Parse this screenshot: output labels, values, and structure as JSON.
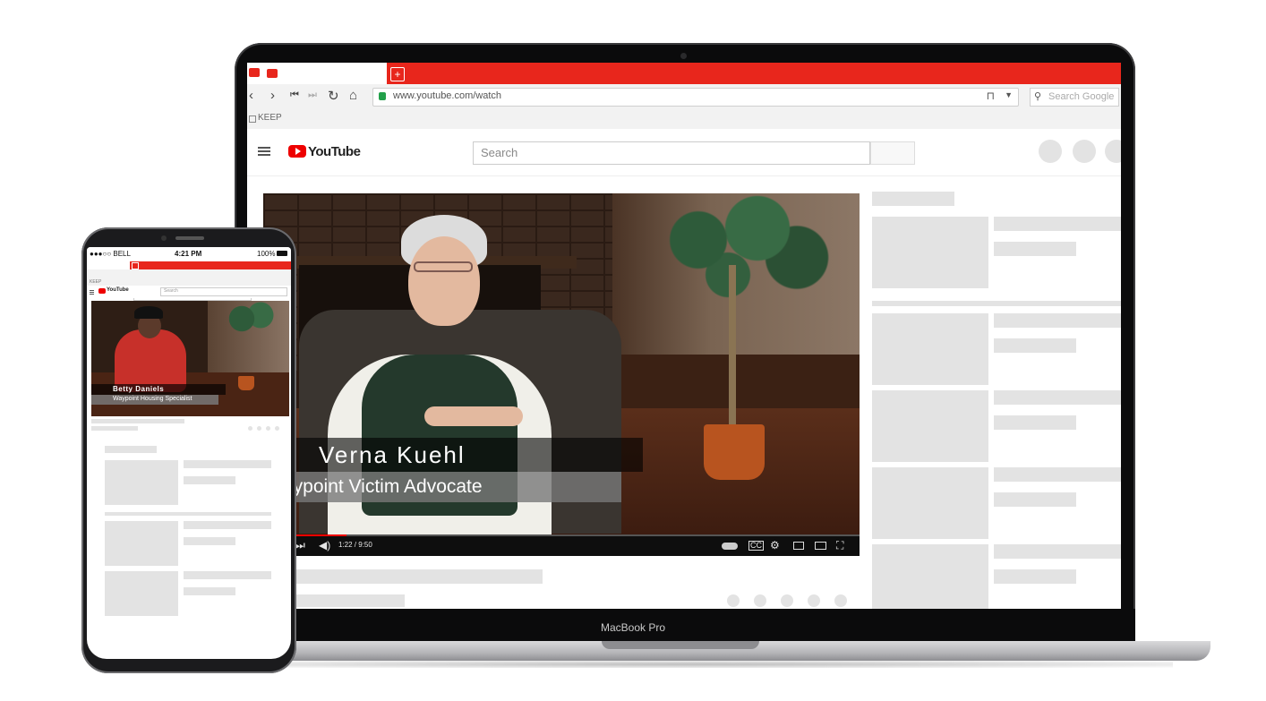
{
  "browser": {
    "url": "www.youtube.com/watch",
    "search_placeholder": "Search Google",
    "bookmark_label": "KEEP"
  },
  "youtube": {
    "logo_text": "YouTube",
    "search_placeholder": "Search"
  },
  "video": {
    "lower_third_name": "Verna Kuehl",
    "lower_third_title": "aypoint Victim Advocate",
    "time_display": "1:22 / 9:50",
    "progress_fraction": 0.14
  },
  "laptop": {
    "label": "MacBook Pro"
  },
  "phone": {
    "carrier": "●●●○○ BELL",
    "time": "4:21 PM",
    "battery": "100%",
    "youtube_logo_text": "YouTube",
    "search_placeholder": "Search",
    "lower_third_name": "Betty Daniels",
    "lower_third_title": "Waypoint Housing Specialist",
    "bookmark_label": "KEEP"
  },
  "colors": {
    "accent_red": "#e8261c",
    "youtube_red": "#ee0000"
  },
  "icons": [
    "back-icon",
    "forward-icon",
    "skip-back-icon",
    "skip-forward-icon",
    "reload-icon",
    "home-icon",
    "lock-icon",
    "bookmark-icon",
    "search-icon",
    "menu-icon",
    "play-next-icon",
    "volume-icon",
    "autoplay-icon",
    "captions-icon",
    "settings-icon",
    "miniplayer-icon",
    "theater-icon",
    "fullscreen-icon"
  ]
}
